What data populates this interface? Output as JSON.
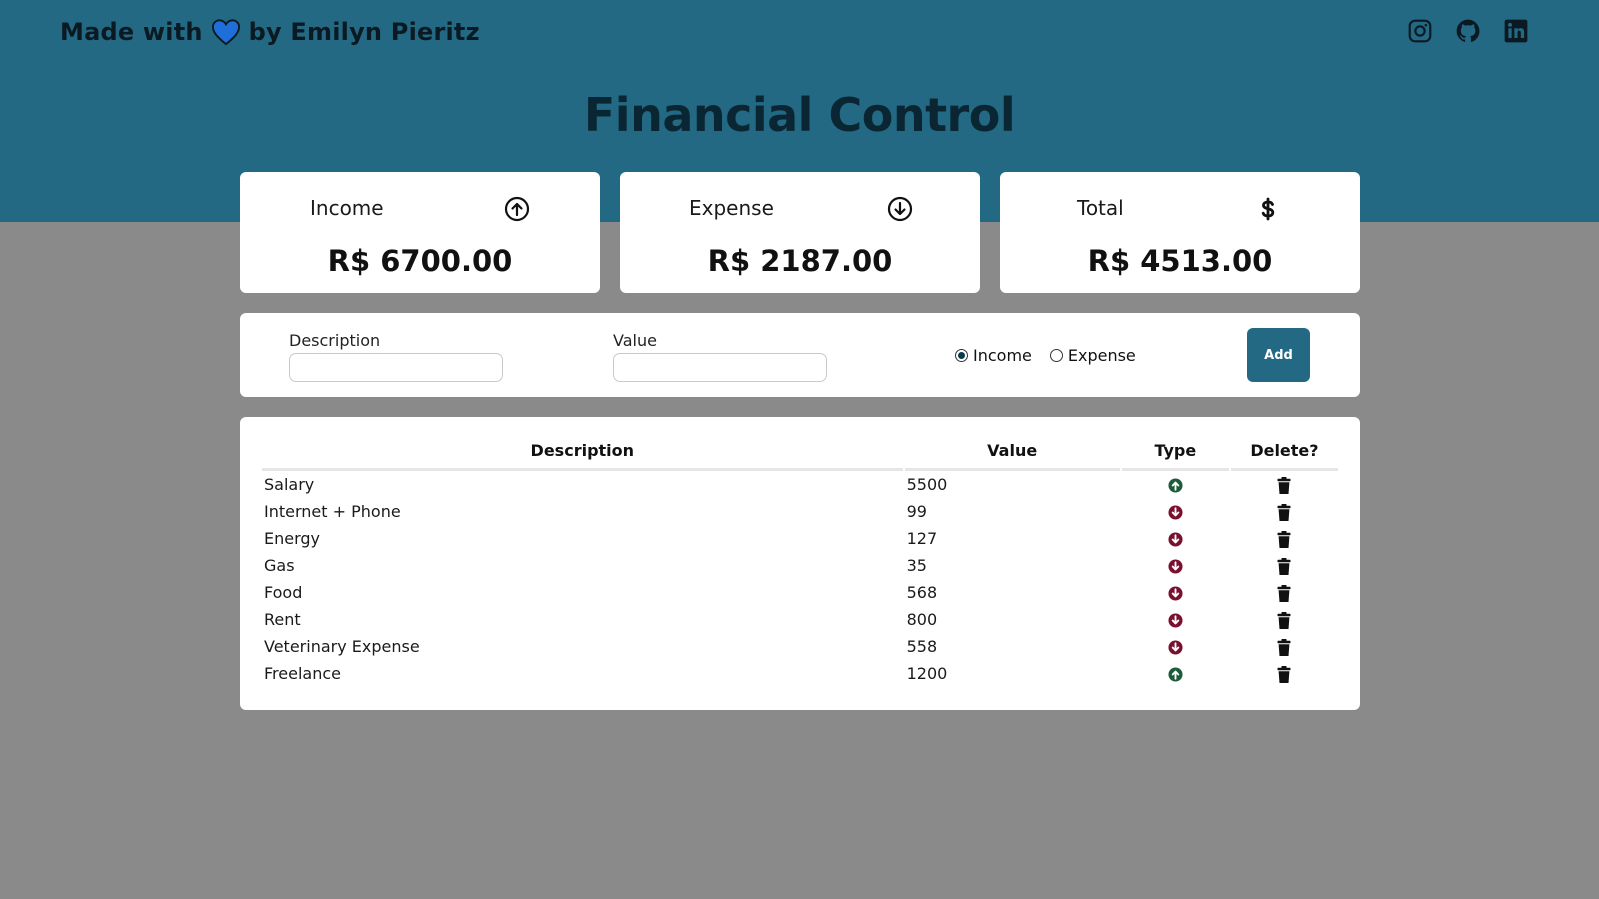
{
  "header": {
    "made_with_prefix": "Made with",
    "made_with_suffix": "by Emilyn Pieritz",
    "heart_icon": "heart-icon",
    "heart_color": "#1e6fd9",
    "social": [
      "instagram-icon",
      "github-icon",
      "linkedin-icon"
    ],
    "title": "Financial Control",
    "background_color": "#236984"
  },
  "summary": {
    "income": {
      "label": "Income",
      "amount": "R$ 6700.00",
      "icon": "arrow-up-circle-icon"
    },
    "expense": {
      "label": "Expense",
      "amount": "R$ 2187.00",
      "icon": "arrow-down-circle-icon"
    },
    "total": {
      "label": "Total",
      "amount": "R$ 4513.00",
      "icon": "dollar-icon"
    }
  },
  "form": {
    "description_label": "Description",
    "description_value": "",
    "value_label": "Value",
    "value_value": "",
    "radio_income": "Income",
    "radio_expense": "Expense",
    "selected_type": "Income",
    "add_label": "Add"
  },
  "table": {
    "headers": [
      "Description",
      "Value",
      "Type",
      "Delete?"
    ],
    "rows": [
      {
        "description": "Salary",
        "value": "5500",
        "type": "income"
      },
      {
        "description": "Internet + Phone",
        "value": "99",
        "type": "expense"
      },
      {
        "description": "Energy",
        "value": "127",
        "type": "expense"
      },
      {
        "description": "Gas",
        "value": "35",
        "type": "expense"
      },
      {
        "description": "Food",
        "value": "568",
        "type": "expense"
      },
      {
        "description": "Rent",
        "value": "800",
        "type": "expense"
      },
      {
        "description": "Veterinary Expense",
        "value": "558",
        "type": "expense"
      },
      {
        "description": "Freelance",
        "value": "1200",
        "type": "income"
      }
    ],
    "income_color": "#1c5c3a",
    "expense_color": "#7a1030"
  }
}
